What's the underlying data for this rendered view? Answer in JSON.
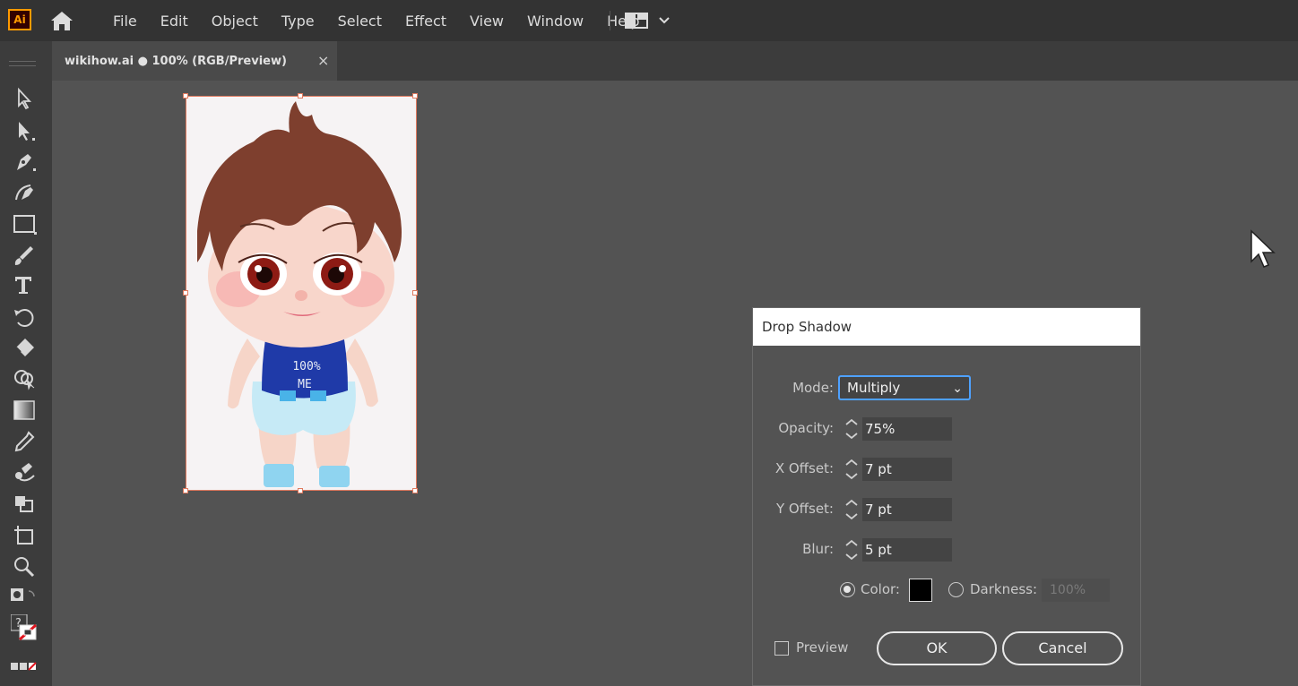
{
  "app": {
    "logo_text": "Ai"
  },
  "menu": [
    "File",
    "Edit",
    "Object",
    "Type",
    "Select",
    "Effect",
    "View",
    "Window",
    "Help"
  ],
  "tab": {
    "title": "wikihow.ai ● 100% (RGB/Preview)",
    "close": "×"
  },
  "toolbar": {
    "tools": [
      "selection-tool",
      "direct-selection-tool",
      "pen-tool",
      "curvature-tool",
      "rectangle-tool",
      "paintbrush-tool",
      "type-tool",
      "rotate-tool",
      "eraser-tool",
      "shape-builder-tool",
      "gradient-tool",
      "eyedropper-tool",
      "blend-tool",
      "live-paint-tool",
      "artboard-tool",
      "zoom-tool"
    ],
    "unknown_label": "?"
  },
  "artboard": {
    "shirt_text_line1": "100%",
    "shirt_text_line2": "ME"
  },
  "dialog": {
    "title": "Drop Shadow",
    "mode_label": "Mode:",
    "mode_value": "Multiply",
    "opacity_label": "Opacity:",
    "opacity_value": "75%",
    "x_offset_label": "X Offset:",
    "x_offset_value": "7 pt",
    "y_offset_label": "Y Offset:",
    "y_offset_value": "7 pt",
    "blur_label": "Blur:",
    "blur_value": "5 pt",
    "color_label": "Color:",
    "color_selected": true,
    "darkness_label": "Darkness:",
    "darkness_value": "100%",
    "preview_label": "Preview",
    "preview_checked": false,
    "ok_label": "OK",
    "cancel_label": "Cancel"
  },
  "colors": {
    "menubar_bg": "#333333",
    "canvas_bg": "#535353",
    "selection_outline": "#e07a5f",
    "focus_blue": "#4ea1ff",
    "shadow_color": "#000000"
  }
}
